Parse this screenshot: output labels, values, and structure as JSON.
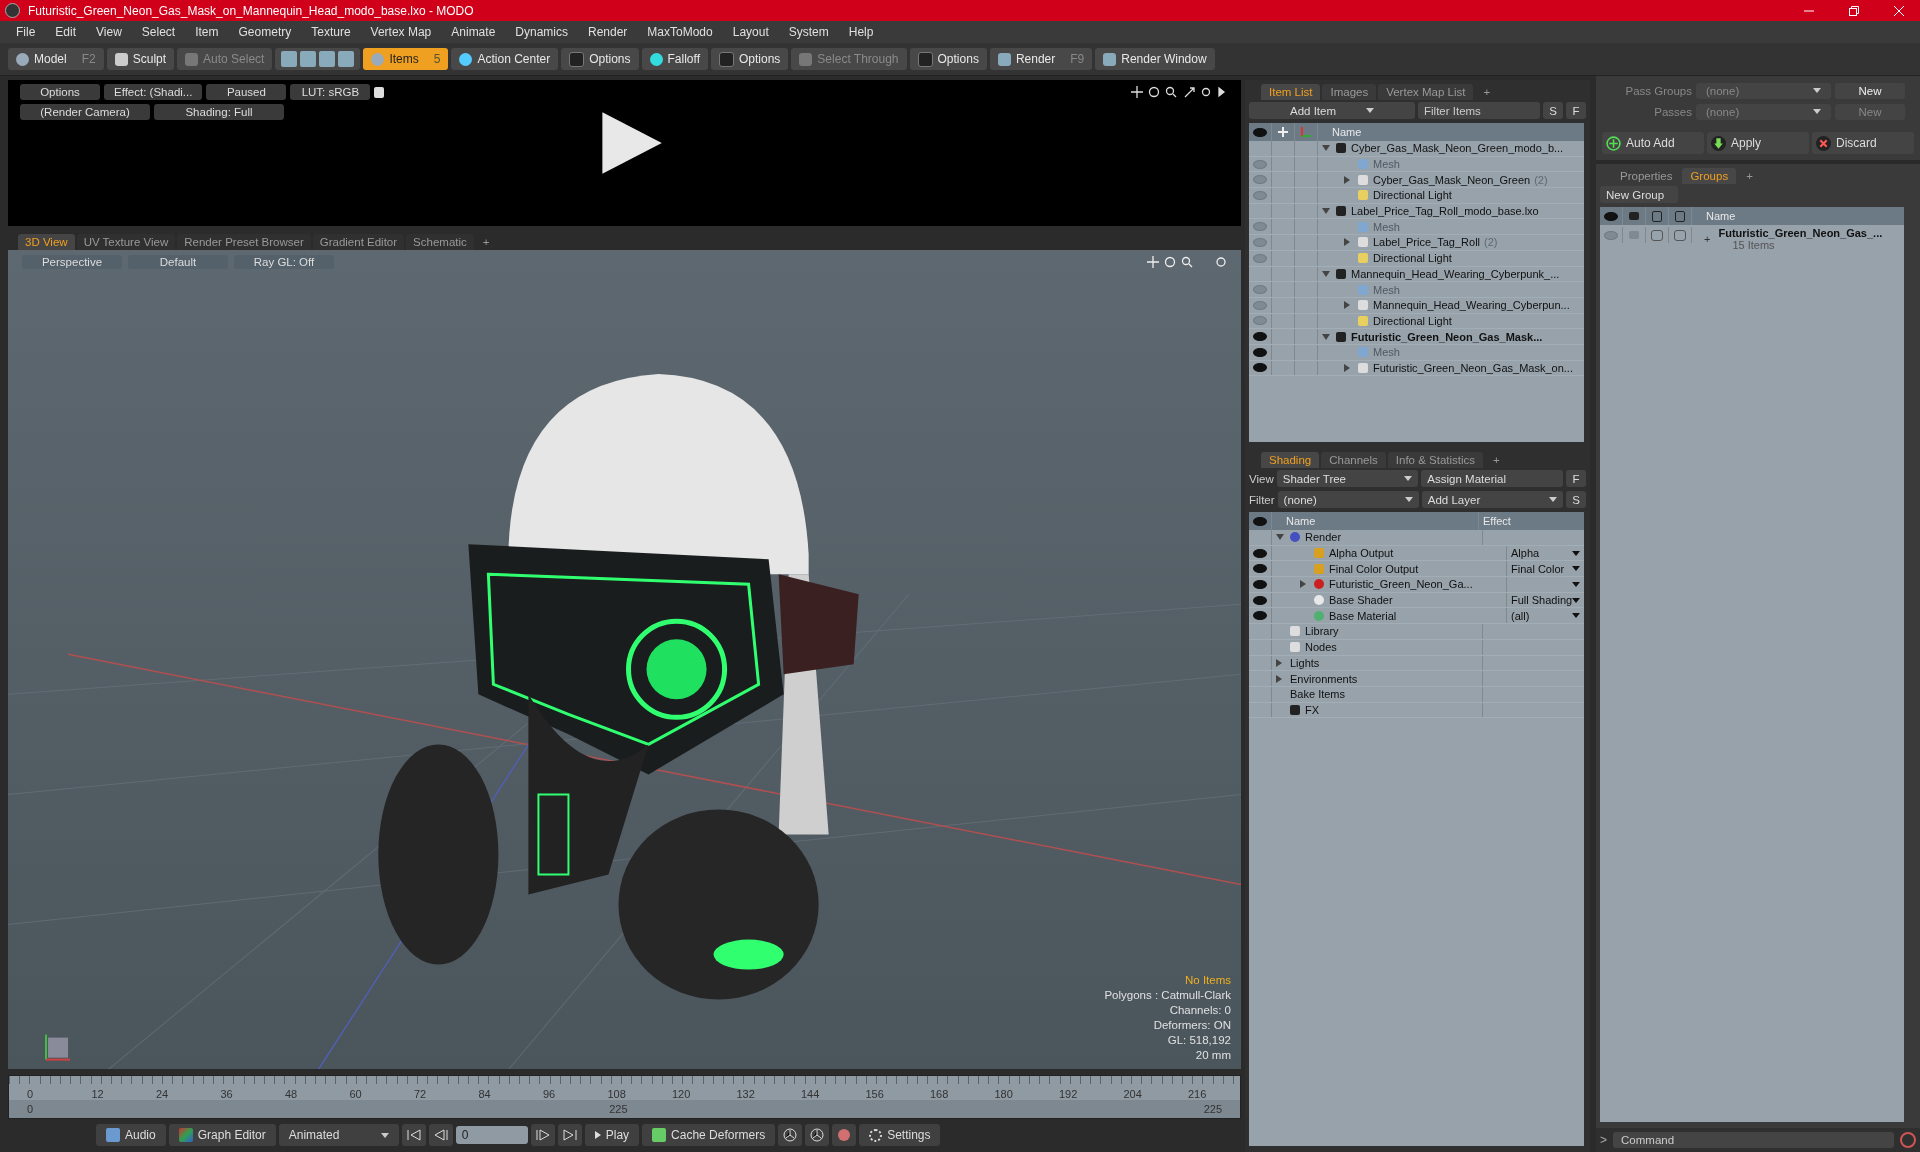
{
  "window": {
    "title": "Futuristic_Green_Neon_Gas_Mask_on_Mannequin_Head_modo_base.lxo - MODO"
  },
  "menu": [
    "File",
    "Edit",
    "View",
    "Select",
    "Item",
    "Geometry",
    "Texture",
    "Vertex Map",
    "Animate",
    "Dynamics",
    "Render",
    "MaxToModo",
    "Layout",
    "System",
    "Help"
  ],
  "toolbar": [
    {
      "kind": "mode",
      "label": "Model",
      "shortcut": "F2",
      "selected": false
    },
    {
      "kind": "brush",
      "label": "Sculpt",
      "selected": false
    },
    {
      "kind": "auto",
      "label": "Auto Select",
      "disabled": true
    },
    {
      "kind": "select-icons"
    },
    {
      "kind": "mode",
      "label": "Items",
      "shortcut": "5",
      "selected": true
    },
    {
      "kind": "center",
      "label": "Action Center",
      "disabled": false
    },
    {
      "kind": "options",
      "label": "Options",
      "disabled": false
    },
    {
      "kind": "falloff",
      "label": "Falloff",
      "disabled": false
    },
    {
      "kind": "options",
      "label": "Options",
      "disabled": false
    },
    {
      "kind": "through",
      "label": "Select Through",
      "disabled": true
    },
    {
      "kind": "options",
      "label": "Options",
      "disabled": false
    },
    {
      "kind": "render",
      "label": "Render",
      "shortcut": "F9"
    },
    {
      "kind": "window",
      "label": "Render Window"
    }
  ],
  "preview": {
    "row1": [
      "Options",
      "Effect: (Shadi...",
      "Paused",
      "LUT: sRGB"
    ],
    "row2": [
      "(Render Camera)",
      "Shading: Full"
    ]
  },
  "viewport_tabs": [
    {
      "label": "3D View",
      "selected": true
    },
    {
      "label": "UV Texture View",
      "selected": false
    },
    {
      "label": "Render Preset Browser",
      "selected": false
    },
    {
      "label": "Gradient Editor",
      "selected": false
    },
    {
      "label": "Schematic",
      "selected": false
    }
  ],
  "viewport_add_tab": "+",
  "viewport_bar": [
    "Perspective",
    "Default",
    "Ray GL: Off"
  ],
  "overlay": {
    "status": "No Items",
    "lines": [
      "Polygons : Catmull-Clark",
      "Channels: 0",
      "Deformers: ON",
      "GL: 518,192",
      "20 mm"
    ]
  },
  "timeline": {
    "ticks": [
      "0",
      "12",
      "24",
      "36",
      "48",
      "60",
      "72",
      "84",
      "96",
      "108",
      "120",
      "132",
      "144",
      "156",
      "168",
      "180",
      "192",
      "204",
      "216"
    ],
    "range_start": "0",
    "range_mid": "225",
    "range_end": "225"
  },
  "bottom_bar": {
    "audio": "Audio",
    "graph_editor": "Graph Editor",
    "mode": "Animated",
    "frame": "0",
    "play": "Play",
    "cache": "Cache Deformers",
    "settings": "Settings"
  },
  "item_list": {
    "tabs": [
      {
        "label": "Item List",
        "selected": true
      },
      {
        "label": "Images",
        "selected": false
      },
      {
        "label": "Vertex Map List",
        "selected": false
      }
    ],
    "add_tab": "+",
    "add_item": "Add Item",
    "filter": {
      "placeholder": "Filter Items"
    },
    "s": "S",
    "f": "F",
    "name_header": "Name",
    "rows": [
      {
        "kind": "scene",
        "name": "Cyber_Gas_Mask_Neon_Green_modo_b...",
        "active": false,
        "expanded": true,
        "children": [
          {
            "kind": "mesh",
            "name": "Mesh",
            "visible": false
          },
          {
            "kind": "group",
            "name": "Cyber_Gas_Mask_Neon_Green",
            "count": "(2)",
            "visible": false,
            "expanded": false
          },
          {
            "kind": "light",
            "name": "Directional Light",
            "visible": false
          }
        ]
      },
      {
        "kind": "scene",
        "name": "Label_Price_Tag_Roll_modo_base.lxo",
        "active": false,
        "expanded": true,
        "children": [
          {
            "kind": "mesh",
            "name": "Mesh",
            "visible": false
          },
          {
            "kind": "group",
            "name": "Label_Price_Tag_Roll",
            "count": "(2)",
            "visible": false,
            "expanded": false
          },
          {
            "kind": "light",
            "name": "Directional Light",
            "visible": false
          }
        ]
      },
      {
        "kind": "scene",
        "name": "Mannequin_Head_Wearing_Cyberpunk_...",
        "active": false,
        "expanded": true,
        "children": [
          {
            "kind": "mesh",
            "name": "Mesh",
            "visible": false
          },
          {
            "kind": "group",
            "name": "Mannequin_Head_Wearing_Cyberpun...",
            "visible": false,
            "expanded": false
          },
          {
            "kind": "light",
            "name": "Directional Light",
            "visible": false
          }
        ]
      },
      {
        "kind": "scene",
        "name": "Futuristic_Green_Neon_Gas_Mask...",
        "active": true,
        "visible": true,
        "expanded": true,
        "children": [
          {
            "kind": "mesh",
            "name": "Mesh",
            "visible": true
          },
          {
            "kind": "group",
            "name": "Futuristic_Green_Neon_Gas_Mask_on...",
            "visible": true,
            "expanded": false
          }
        ]
      }
    ]
  },
  "shading": {
    "tabs": [
      {
        "label": "Shading",
        "selected": true
      },
      {
        "label": "Channels",
        "selected": false
      },
      {
        "label": "Info & Statistics",
        "selected": false
      }
    ],
    "add_tab": "+",
    "view_label": "View",
    "view": "Shader Tree",
    "assign": "Assign Material",
    "f": "F",
    "filter_label": "Filter",
    "filter": "(none)",
    "add_layer": "Add Layer",
    "s": "S",
    "name_header": "Name",
    "effect_header": "Effect",
    "rows": [
      {
        "kind": "render",
        "name": "Render",
        "expanded": true,
        "children": [
          {
            "kind": "output",
            "name": "Alpha Output",
            "visible": true,
            "effect": "Alpha",
            "dropdown": true
          },
          {
            "kind": "output",
            "name": "Final Color Output",
            "visible": true,
            "effect": "Final Color",
            "dropdown": true
          },
          {
            "kind": "mask",
            "name": "Futuristic_Green_Neon_Ga...",
            "visible": true,
            "expanded": false,
            "dropdown": true
          },
          {
            "kind": "shader",
            "name": "Base Shader",
            "visible": true,
            "effect": "Full Shading",
            "dropdown": true
          },
          {
            "kind": "material",
            "name": "Base Material",
            "visible": true,
            "effect": "(all)",
            "dropdown": true
          }
        ]
      },
      {
        "kind": "folder",
        "name": "Library"
      },
      {
        "kind": "folder",
        "name": "Nodes"
      },
      {
        "kind": "plain",
        "name": "Lights",
        "expanded": false
      },
      {
        "kind": "plain",
        "name": "Environments",
        "expanded": false
      },
      {
        "kind": "plain",
        "name": "Bake Items"
      },
      {
        "kind": "fx",
        "name": "FX"
      }
    ]
  },
  "passes": {
    "pass_groups_label": "Pass Groups",
    "pass_groups": "(none)",
    "new": "New",
    "passes_label": "Passes",
    "passes": "(none)",
    "new_disabled": "New",
    "auto_add": "Auto Add",
    "apply": "Apply",
    "discard": "Discard"
  },
  "groups": {
    "tabs": [
      {
        "label": "Properties",
        "selected": false
      },
      {
        "label": "Groups",
        "selected": true
      }
    ],
    "add_tab": "+",
    "new_group": "New Group",
    "name_header": "Name",
    "rows": [
      {
        "name": "Futuristic_Green_Neon_Gas_...",
        "count": "15 Items",
        "expand": "+",
        "column_3_checked": false,
        "column_4_checked": false
      }
    ]
  },
  "command": {
    "prompt": ">",
    "placeholder": "Command"
  }
}
